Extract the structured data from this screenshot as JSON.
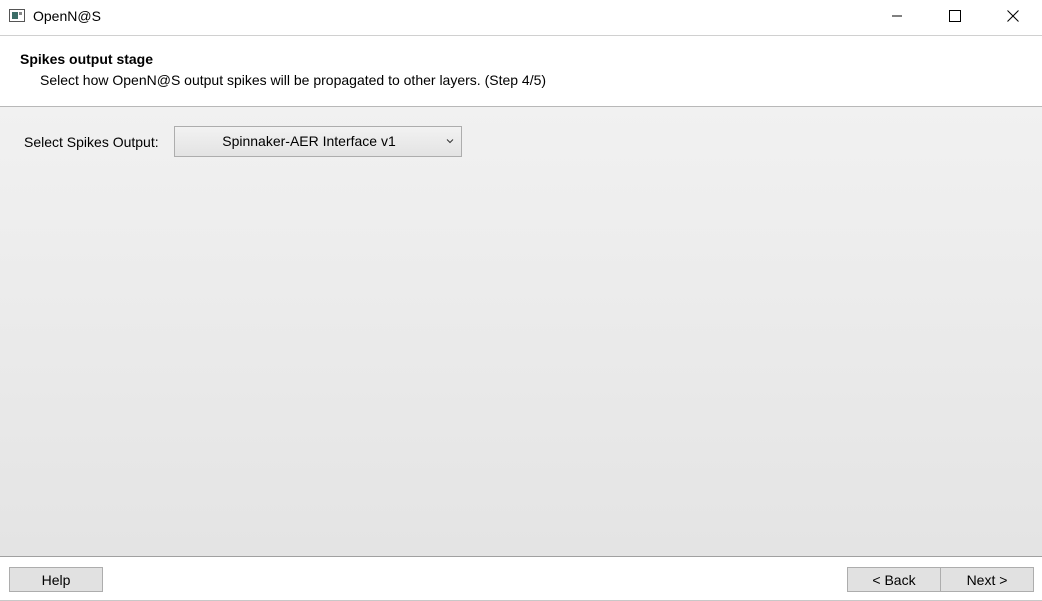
{
  "window": {
    "title": "OpenN@S"
  },
  "header": {
    "title": "Spikes output stage",
    "subtitle": "Select how OpenN@S output spikes will be propagated to other layers. (Step 4/5)"
  },
  "content": {
    "spikes_output_label": "Select Spikes Output:",
    "spikes_output_value": "Spinnaker-AER Interface v1"
  },
  "footer": {
    "help_label": "Help",
    "back_label": "< Back",
    "next_label": "Next >"
  },
  "icons": {
    "app": "app-icon",
    "minimize": "minimize-icon",
    "maximize": "maximize-icon",
    "close": "close-icon",
    "dropdown": "chevron-down-icon"
  }
}
